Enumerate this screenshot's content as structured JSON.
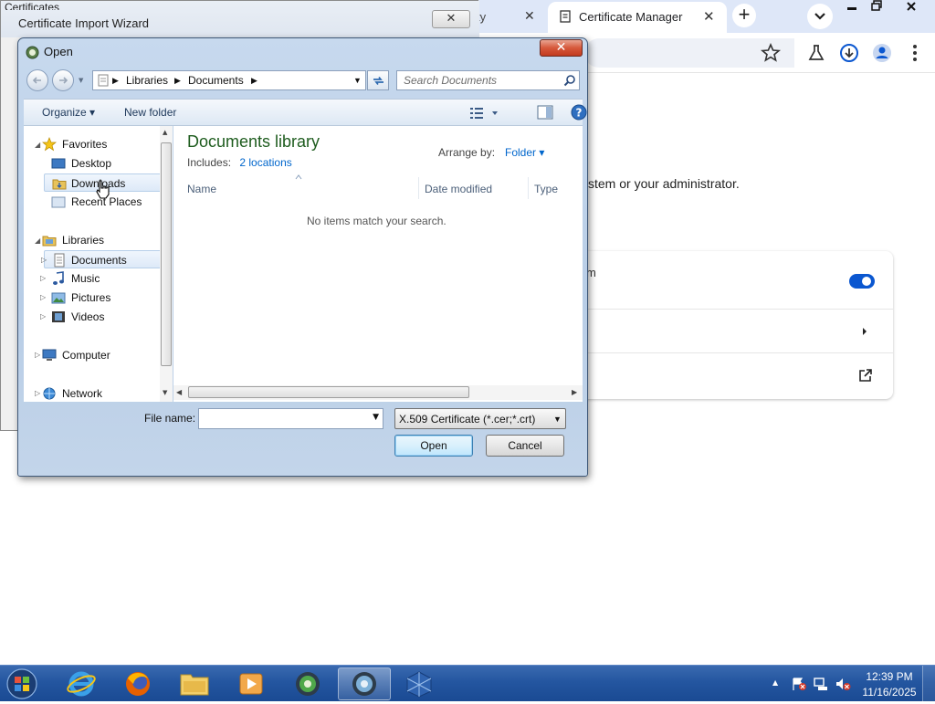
{
  "browser": {
    "tabs": [
      {
        "label": "ty",
        "close": "✕"
      },
      {
        "label": "Certificate Manager",
        "close": "✕"
      }
    ],
    "new_tab": "+",
    "page_text": "stem or your administrator.",
    "card_row_text": "m"
  },
  "wizard": {
    "title": "Certificate Import Wizard",
    "behind_label": "Certificates",
    "close": "✕"
  },
  "dialog": {
    "title": "Open",
    "close": "✕",
    "breadcrumb": [
      "Libraries",
      "Documents"
    ],
    "search_placeholder": "Search Documents",
    "toolbar": {
      "organize": "Organize ▾",
      "new_folder": "New folder"
    },
    "nav": {
      "favorites": "Favorites",
      "desktop": "Desktop",
      "downloads": "Downloads",
      "recent_places": "Recent Places",
      "libraries": "Libraries",
      "documents": "Documents",
      "music": "Music",
      "pictures": "Pictures",
      "videos": "Videos",
      "computer": "Computer",
      "network": "Network"
    },
    "content": {
      "library_title": "Documents library",
      "includes_label": "Includes:",
      "includes_link": "2 locations",
      "arrange_by_label": "Arrange by:",
      "arrange_by_value": "Folder ▾",
      "columns": [
        "Name",
        "Date modified",
        "Type"
      ],
      "empty_message": "No items match your search."
    },
    "file_name_label": "File name:",
    "file_name_value": "",
    "filter": "X.509 Certificate (*.cer;*.crt)",
    "open_button": "Open",
    "cancel_button": "Cancel"
  },
  "taskbar": {
    "time": "12:39 PM",
    "date": "11/16/2025"
  },
  "colors": {
    "library_title": "#1e5c1e",
    "link": "#0066cc",
    "taskbar": "#2456a0",
    "chrome_accent": "#0b57d0"
  }
}
